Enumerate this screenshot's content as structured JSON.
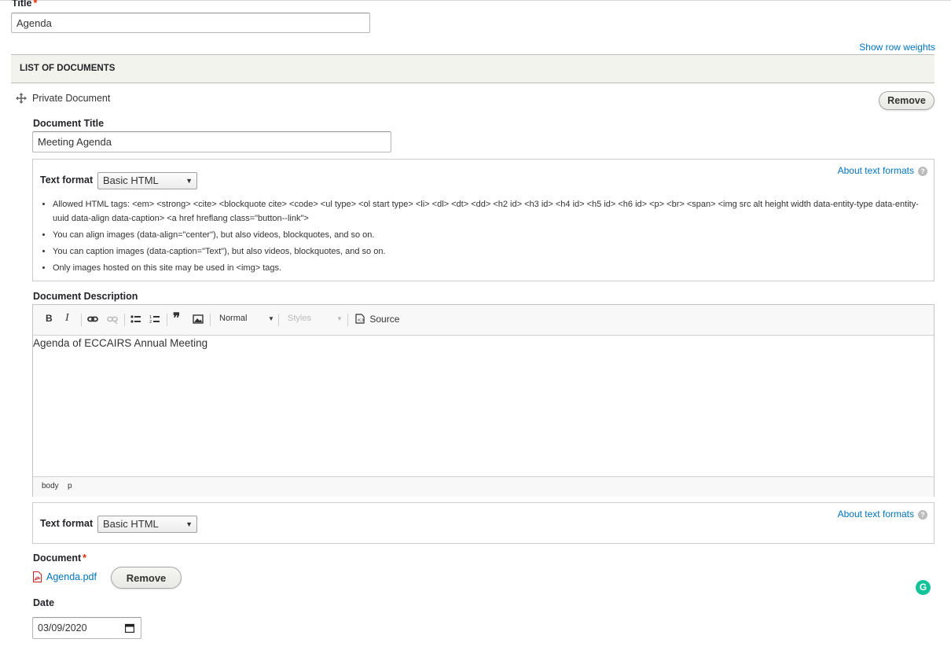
{
  "title_field": {
    "label": "Title",
    "required_mark": "*",
    "value": "Agenda"
  },
  "table_controls": {
    "show_row_weights": "Show row weights"
  },
  "list": {
    "header": "LIST OF DOCUMENTS"
  },
  "item": {
    "type_label": "Private Document",
    "remove_label": "Remove",
    "doc_title": {
      "label": "Document Title",
      "value": "Meeting Agenda"
    },
    "format1": {
      "label": "Text format",
      "selected": "Basic HTML",
      "about": "About text formats",
      "tips": [
        "Allowed HTML tags: <em> <strong> <cite> <blockquote cite> <code> <ul type> <ol start type> <li> <dl> <dt> <dd> <h2 id> <h3 id> <h4 id> <h5 id> <h6 id> <p> <br> <span> <img src alt height width data-entity-type data-entity-uuid data-align data-caption> <a href hreflang class=\"button--link\">",
        "You can align images (data-align=\"center\"), but also videos, blockquotes, and so on.",
        "You can caption images (data-caption=\"Text\"), but also videos, blockquotes, and so on.",
        "Only images hosted on this site may be used in <img> tags."
      ]
    },
    "description": {
      "label": "Document Description",
      "toolbar": {
        "bold": "B",
        "italic": "I",
        "blockquote": "❞",
        "format_select": "Normal",
        "styles_select": "Styles",
        "source": "Source"
      },
      "content": "Agenda of ECCAIRS Annual Meeting",
      "path": [
        "body",
        "p"
      ]
    },
    "format2": {
      "label": "Text format",
      "selected": "Basic HTML",
      "about": "About text formats"
    },
    "document": {
      "label": "Document",
      "required_mark": "*",
      "file_name": "Agenda.pdf",
      "remove_label": "Remove"
    },
    "date": {
      "label": "Date",
      "value": "03/09/2020"
    }
  },
  "colors": {
    "link": "#0074bd",
    "required": "#e62600",
    "grammarly": "#15c39a"
  },
  "icons": [
    "drag-handle-icon",
    "pdf-file-icon",
    "calendar-icon",
    "help-icon",
    "grammarly-icon"
  ]
}
